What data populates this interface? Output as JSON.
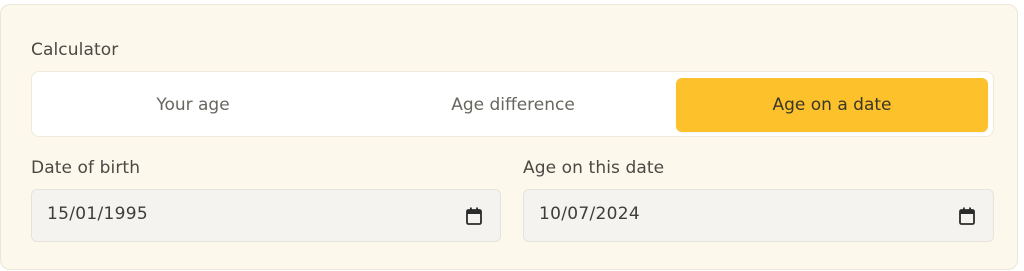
{
  "calculator": {
    "label": "Calculator",
    "tabs": [
      {
        "label": "Your age",
        "selected": false
      },
      {
        "label": "Age difference",
        "selected": false
      },
      {
        "label": "Age on a date",
        "selected": true
      }
    ]
  },
  "fields": {
    "date_of_birth": {
      "label": "Date of birth",
      "value": "15/01/1995",
      "icon": "calendar-icon"
    },
    "age_on_date": {
      "label": "Age on this date",
      "value": "10/07/2024",
      "icon": "calendar-icon"
    }
  },
  "colors": {
    "card_bg": "#fdf8ec",
    "accent": "#fcc12b",
    "field_bg": "#f5f3ef"
  }
}
